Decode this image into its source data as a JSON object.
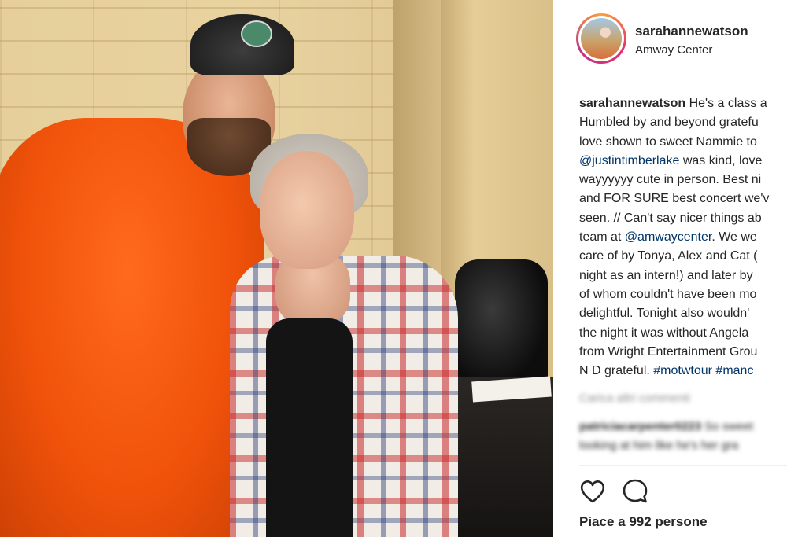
{
  "post": {
    "username": "sarahannewatson",
    "location": "Amway Center"
  },
  "caption": {
    "user": "sarahannewatson",
    "line1_text": " He's a class a",
    "line2": "Humbled by and beyond gratefu",
    "line3": "love shown to sweet Nammie to",
    "line4_mention": "@justintimberlake",
    "line4_text": " was kind, love",
    "line5": "wayyyyyy cute in person. Best ni",
    "line6": "and FOR SURE best concert we'v",
    "line7": "seen. // Can't say nicer things ab",
    "line8_text": "team at ",
    "line8_mention": "@amwaycenter",
    "line8_text2": ". We we",
    "line9": "care of by Tonya, Alex and Cat (",
    "line10": "night as an intern!) and later by",
    "line11": "of whom couldn't have been mo",
    "line12": "delightful. Tonight also wouldn'",
    "line13": "the night it was without Angela",
    "line14": "from Wright Entertainment Grou",
    "line15_text": "N D grateful. ",
    "line15_tag1": "#motwtour",
    "line15_space": " ",
    "line15_tag2": "#manc"
  },
  "comments": {
    "load_more": "Carica altri commenti",
    "comment1_user": "patriciacarpenter0223",
    "comment1_text": " So sweet",
    "comment2_text": "looking at him like he's her gra"
  },
  "actions": {
    "like_icon": "heart-icon",
    "comment_icon": "comment-bubble-icon"
  },
  "likes": {
    "text": "Piace a 992 persone"
  },
  "colors": {
    "text": "#262626",
    "link": "#003569",
    "muted": "#8e8e8e",
    "divider": "#efefef"
  }
}
